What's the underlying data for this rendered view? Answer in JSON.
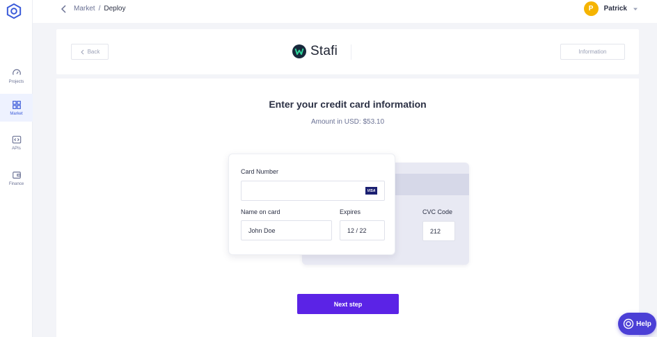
{
  "sidebar": {
    "items": [
      {
        "label": "Projects",
        "icon": "gauge-icon"
      },
      {
        "label": "Market",
        "icon": "grid-icon",
        "active": true
      },
      {
        "label": "APIs",
        "icon": "code-icon"
      },
      {
        "label": "Finance",
        "icon": "wallet-icon"
      }
    ]
  },
  "breadcrumb": {
    "parent": "Market",
    "separator": "/",
    "current": "Deploy"
  },
  "user": {
    "initial": "P",
    "name": "Patrick"
  },
  "header": {
    "back_label": "Back",
    "brand_name": "Stafi",
    "info_label": "Information"
  },
  "main": {
    "title": "Enter your credit card information",
    "amount": "Amount in USD: $53.10"
  },
  "card_form": {
    "card_number_label": "Card Number",
    "card_number_value": "",
    "card_brand": "VISA",
    "name_label": "Name on card",
    "name_value": "John Doe",
    "expires_label": "Expires",
    "expires_value": "12 / 22",
    "cvc_label": "CVC Code",
    "cvc_value": "212"
  },
  "next_button": "Next step",
  "help_button": "Help",
  "colors": {
    "accent": "#5b23e6",
    "help": "#4b3fd6",
    "avatar": "#f5b400",
    "active_nav": "#3b5bd9"
  }
}
